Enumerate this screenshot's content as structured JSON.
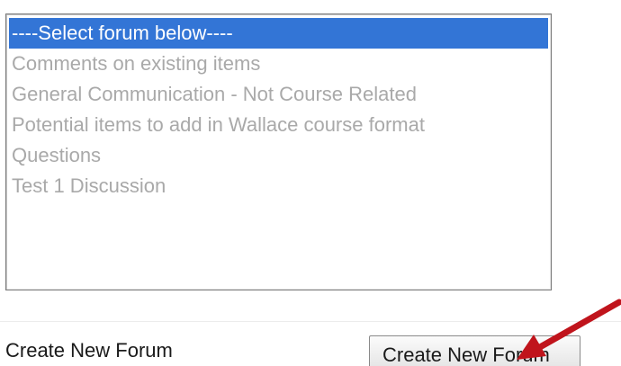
{
  "forum_list": {
    "options": [
      "----Select forum below----",
      "Comments on existing items",
      "General Communication - Not Course Related",
      "Potential items to add in Wallace course format",
      "Questions",
      "Test 1 Discussion"
    ],
    "selected": "----Select forum below----"
  },
  "create_section": {
    "label": "Create New Forum",
    "button_label": "Create New Forum"
  },
  "annotation": {
    "arrow_color": "#c0141c"
  },
  "colors": {
    "selection": "#3375d6",
    "option_text": "#a9a9a9"
  }
}
